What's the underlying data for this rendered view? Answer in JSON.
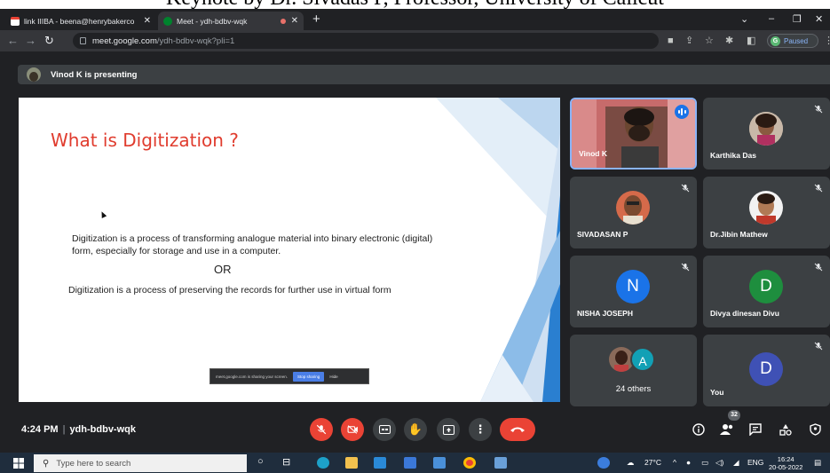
{
  "caption": "Keynote by Dr. Sivadas P, Professor, University of Calicut",
  "browser": {
    "tabs": [
      {
        "label": "link IIIBA - beena@henrybakerco"
      },
      {
        "label": "Meet - ydh-bdbv-wqk"
      }
    ],
    "url_host": "meet.google.com",
    "url_path": "/ydh-bdbv-wqk?pli=1",
    "profile_initial": "G",
    "profile_status": "Paused"
  },
  "meet": {
    "presenting_text": "Vinod K is presenting",
    "slide": {
      "title": "What is Digitization ?",
      "paragraph1": "Digitization is a process of transforming analogue material  into binary electronic (digital) form, especially for storage and use in a computer.",
      "or": "OR",
      "paragraph2": "Digitization is a process of preserving the records for further use in virtual form",
      "sharing_notice": "meet.google.com is sharing your screen.",
      "stop_sharing": "Stop sharing",
      "hide": "Hide"
    },
    "participants": [
      {
        "name": "Vinod K"
      },
      {
        "name": "Karthika Das"
      },
      {
        "name": "SIVADASAN P"
      },
      {
        "name": "Dr.Jibin Mathew"
      },
      {
        "name": "NISHA JOSEPH",
        "initial": "N",
        "color": "#1a73e8"
      },
      {
        "name": "Divya dinesan Divu",
        "initial": "D",
        "color": "#1e8e3e"
      },
      {
        "name": "24 others",
        "initial": "A",
        "color": "#12a0b5"
      },
      {
        "name": "You",
        "initial": "D",
        "color": "#3f51b5"
      }
    ],
    "time": "4:24 PM",
    "meeting_code": "ydh-bdbv-wqk",
    "people_count": "32"
  },
  "taskbar": {
    "search_placeholder": "Type here to search",
    "temperature": "27°C",
    "language": "ENG",
    "time": "16:24",
    "date": "20-05-2022"
  }
}
